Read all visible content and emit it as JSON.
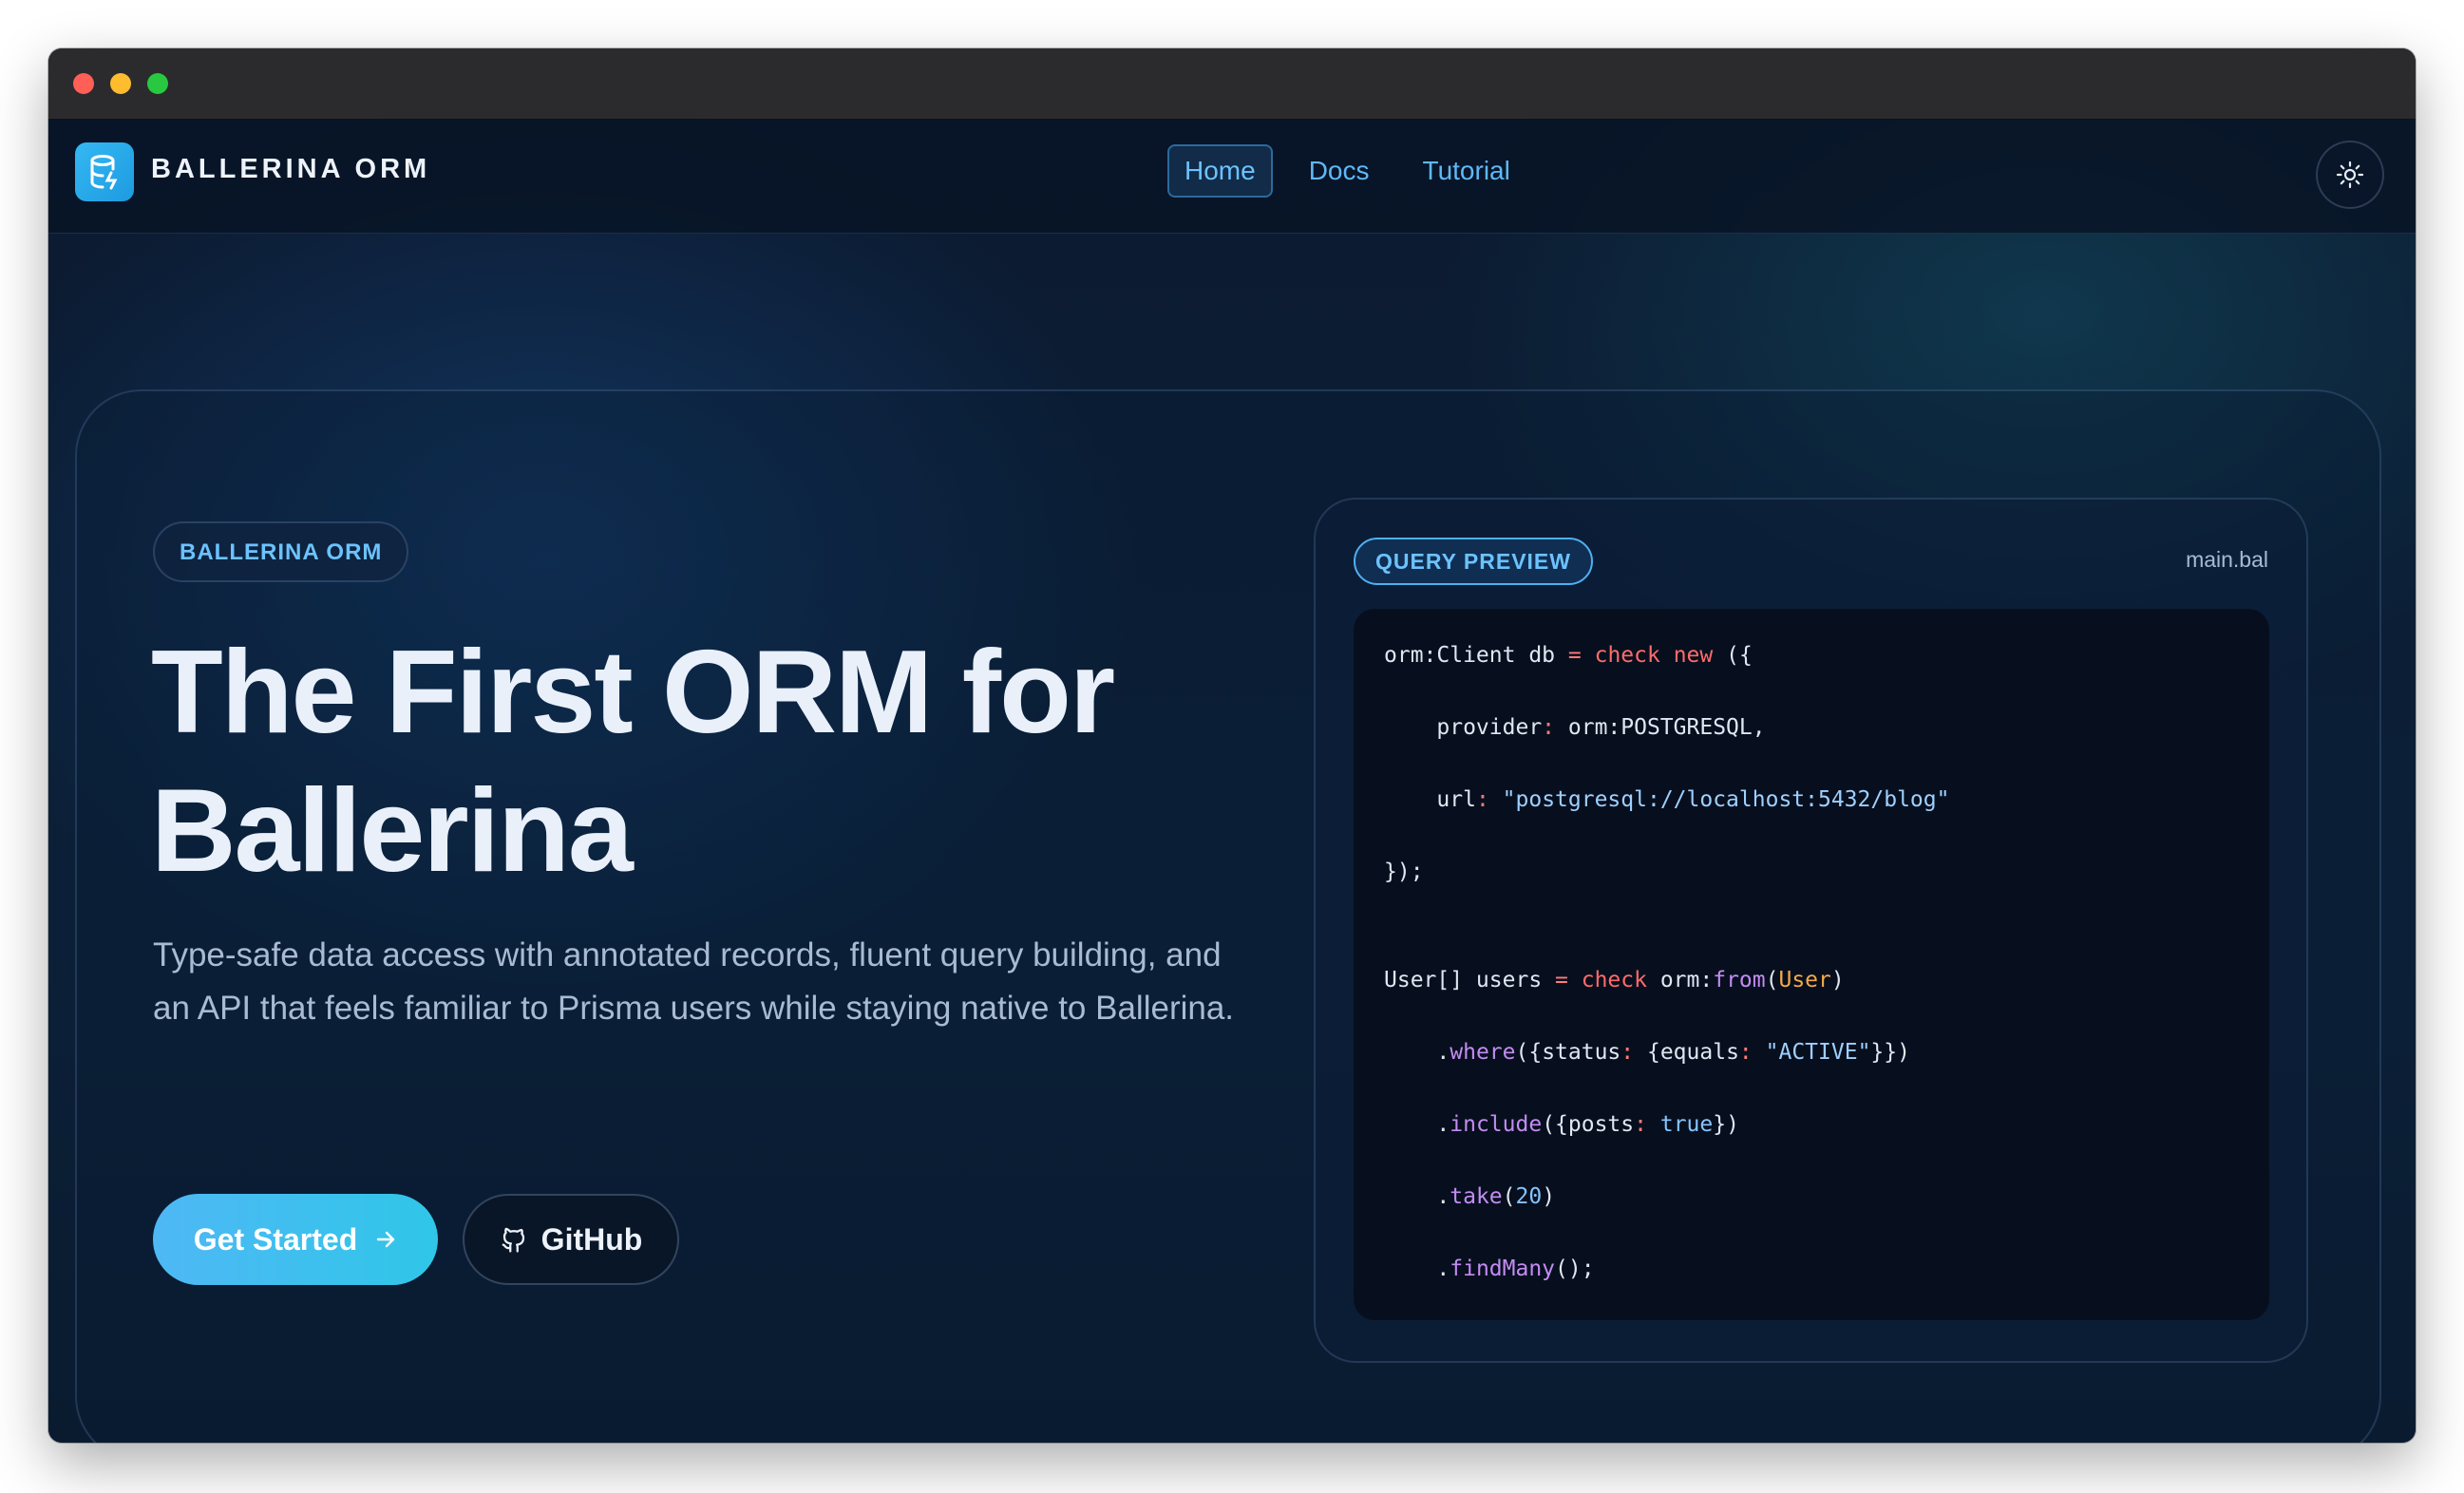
{
  "navbar": {
    "brand": "BALLERINA ORM",
    "links": [
      {
        "label": "Home",
        "active": true
      },
      {
        "label": "Docs",
        "active": false
      },
      {
        "label": "Tutorial",
        "active": false
      }
    ],
    "theme_toggle_icon": "sun-icon"
  },
  "hero": {
    "badge": "BALLERINA ORM",
    "headline": "The First ORM for Ballerina",
    "subtext": "Type-safe data access with annotated records, fluent query building, and an API that feels familiar to Prisma users while staying native to Ballerina.",
    "primary_button": {
      "label": "Get Started",
      "icon": "arrow-right-icon"
    },
    "secondary_button": {
      "label": "GitHub",
      "icon": "github-icon"
    }
  },
  "preview": {
    "badge": "QUERY PREVIEW",
    "filename": "main.bal",
    "code": [
      "orm:Client db = check new ({",
      "    provider: orm:POSTGRESQL,",
      "    url: \"postgresql://localhost:5432/blog\"",
      "});",
      "",
      "User[] users = check orm:from(User)",
      "    .where({status: {equals: \"ACTIVE\"}})",
      "    .include({posts: true})",
      "    .take(20)",
      "    .findMany();"
    ]
  },
  "colors": {
    "accent": "#5fb8f8",
    "keyword": "#ff6b6b",
    "function": "#c38cf2",
    "type": "#f5a94a",
    "string": "#9fd0ff",
    "background": "#0b1628"
  }
}
